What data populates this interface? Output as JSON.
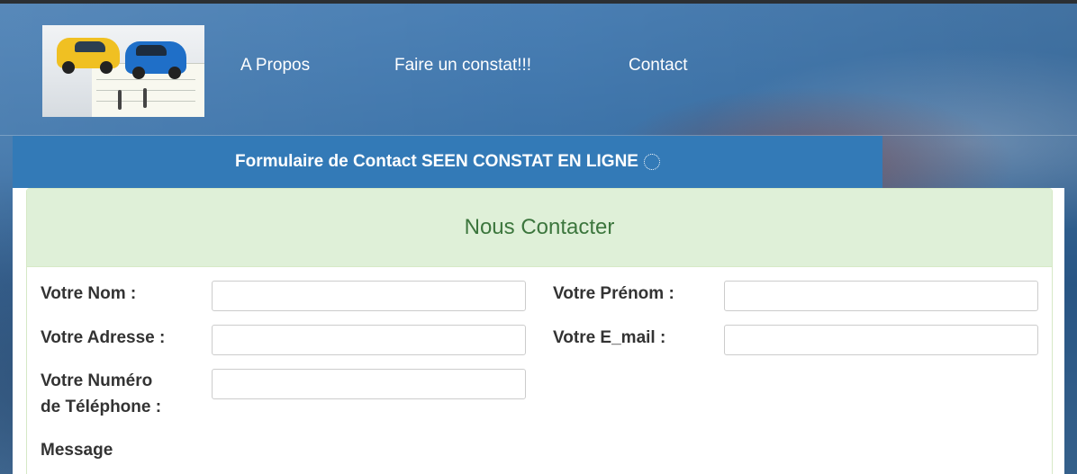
{
  "nav": {
    "items": [
      {
        "label": "A Propos"
      },
      {
        "label": "Faire un constat!!!"
      },
      {
        "label": "Contact"
      }
    ]
  },
  "banner": {
    "title": "Formulaire de Contact SEEN CONSTAT EN LIGNE"
  },
  "panel": {
    "heading": "Nous Contacter"
  },
  "form": {
    "nom_label": "Votre Nom :",
    "nom_value": "",
    "prenom_label": "Votre Prénom :",
    "prenom_value": "",
    "adresse_label": "Votre Adresse :",
    "adresse_value": "",
    "email_label": "Votre E_mail :",
    "email_value": "",
    "telephone_label_line1": "Votre Numéro",
    "telephone_label_line2": "de Téléphone :",
    "telephone_value": "",
    "message_label": "Message"
  },
  "colors": {
    "banner_bg": "#337ab7",
    "panel_heading_bg": "#dff0d8",
    "panel_heading_text": "#3c763d"
  }
}
